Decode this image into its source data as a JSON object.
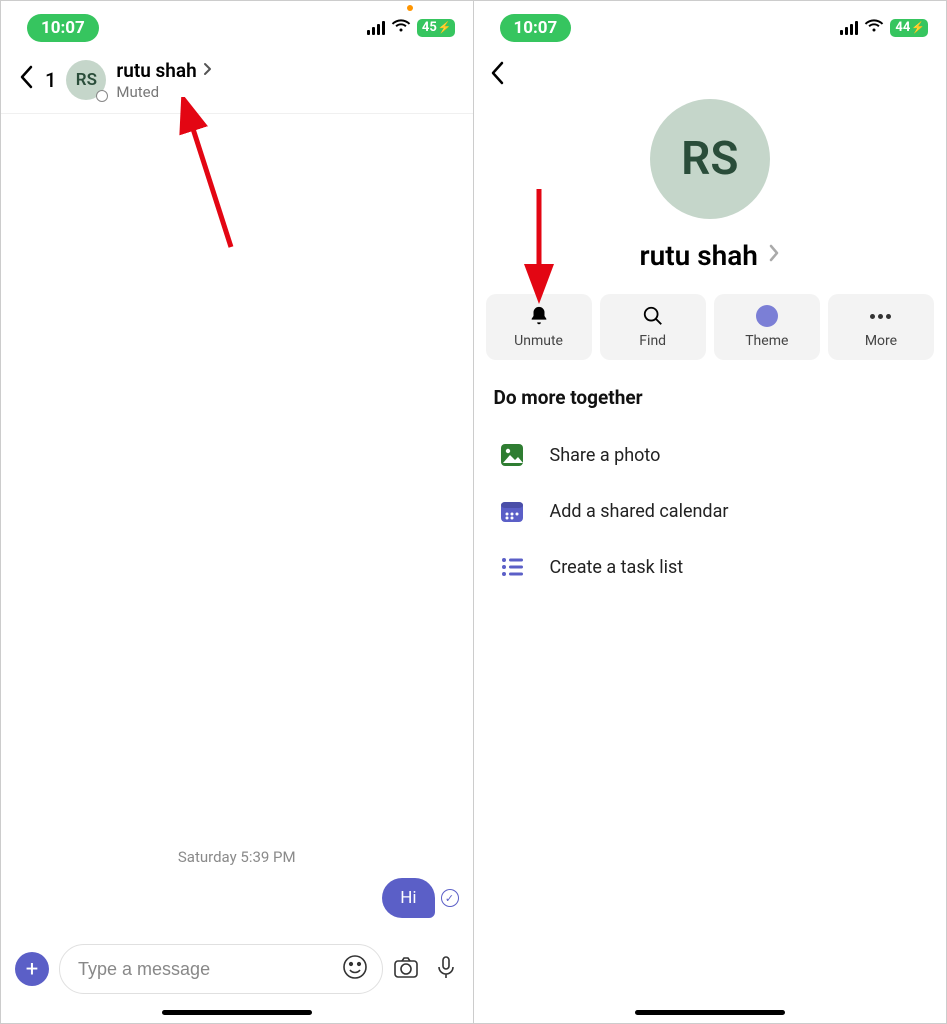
{
  "left": {
    "status": {
      "time": "10:07",
      "battery": "45"
    },
    "header": {
      "unread": "1",
      "avatar_initials": "RS",
      "name": "rutu shah",
      "subtitle": "Muted"
    },
    "timeline": {
      "date_divider": "Saturday 5:39 PM",
      "last_message": "Hi"
    },
    "composer": {
      "placeholder": "Type a message"
    }
  },
  "right": {
    "status": {
      "time": "10:07",
      "battery": "44"
    },
    "profile": {
      "avatar_initials": "RS",
      "name": "rutu shah"
    },
    "actions": {
      "unmute": "Unmute",
      "find": "Find",
      "theme": "Theme",
      "more": "More"
    },
    "section_title": "Do more together",
    "items": {
      "photo": "Share a photo",
      "calendar": "Add a shared calendar",
      "tasks": "Create a task list"
    }
  }
}
